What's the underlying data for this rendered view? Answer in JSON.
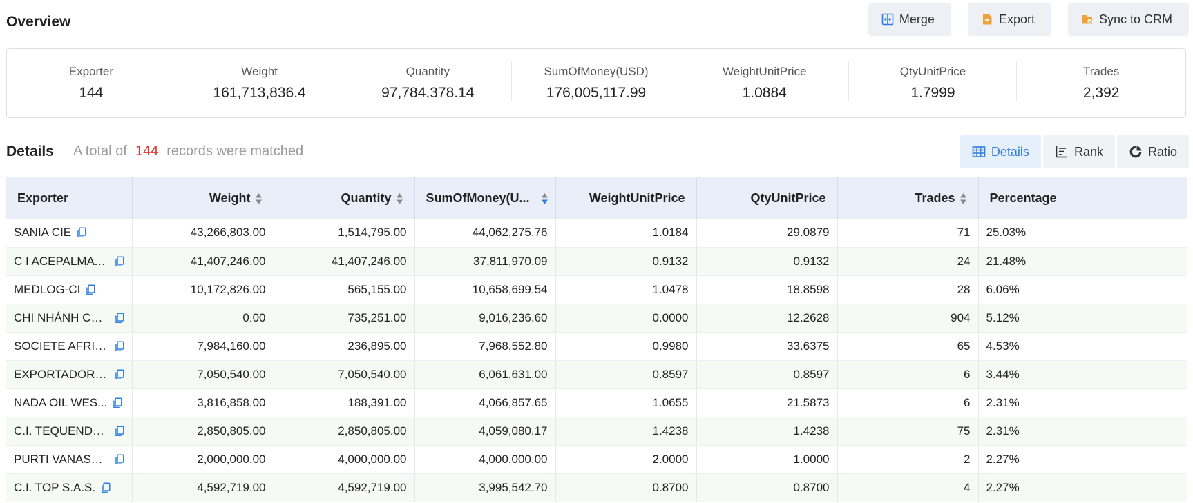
{
  "overview": {
    "title": "Overview",
    "actions": [
      {
        "label": "Merge",
        "icon": "merge-icon"
      },
      {
        "label": "Export",
        "icon": "export-icon"
      },
      {
        "label": "Sync to CRM",
        "icon": "sync-crm-icon"
      }
    ],
    "stats": [
      {
        "label": "Exporter",
        "value": "144"
      },
      {
        "label": "Weight",
        "value": "161,713,836.4"
      },
      {
        "label": "Quantity",
        "value": "97,784,378.14"
      },
      {
        "label": "SumOfMoney(USD)",
        "value": "176,005,117.99"
      },
      {
        "label": "WeightUnitPrice",
        "value": "1.0884"
      },
      {
        "label": "QtyUnitPrice",
        "value": "1.7999"
      },
      {
        "label": "Trades",
        "value": "2,392"
      }
    ]
  },
  "details": {
    "title": "Details",
    "matched_prefix": "A total of",
    "matched_count": "144",
    "matched_suffix": "records were matched",
    "views": [
      {
        "label": "Details",
        "icon": "table-icon",
        "active": true
      },
      {
        "label": "Rank",
        "icon": "rank-icon",
        "active": false
      },
      {
        "label": "Ratio",
        "icon": "pie-icon",
        "active": false
      }
    ]
  },
  "table": {
    "columns": [
      "Exporter",
      "Weight",
      "Quantity",
      "SumOfMoney(U...",
      "WeightUnitPrice",
      "QtyUnitPrice",
      "Trades",
      "Percentage"
    ],
    "rows": [
      [
        "SANIA CIE",
        "43,266,803.00",
        "1,514,795.00",
        "44,062,275.76",
        "1.0184",
        "29.0879",
        "71",
        "25.03%"
      ],
      [
        "C I ACEPALMA S A",
        "41,407,246.00",
        "41,407,246.00",
        "37,811,970.09",
        "0.9132",
        "0.9132",
        "24",
        "21.48%"
      ],
      [
        "MEDLOG-CI",
        "10,172,826.00",
        "565,155.00",
        "10,658,699.54",
        "1.0478",
        "18.8598",
        "28",
        "6.06%"
      ],
      [
        "CHI NHÁNH CÔ...",
        "0.00",
        "735,251.00",
        "9,016,236.60",
        "0.0000",
        "12.2628",
        "904",
        "5.12%"
      ],
      [
        "SOCIETE AFRIC...",
        "7,984,160.00",
        "236,895.00",
        "7,968,552.80",
        "0.9980",
        "33.6375",
        "65",
        "4.53%"
      ],
      [
        "EXPORTADORA ...",
        "7,050,540.00",
        "7,050,540.00",
        "6,061,631.00",
        "0.8597",
        "0.8597",
        "6",
        "3.44%"
      ],
      [
        "NADA OIL WES...",
        "3,816,858.00",
        "188,391.00",
        "4,066,857.65",
        "1.0655",
        "21.5873",
        "6",
        "2.31%"
      ],
      [
        "C.I. TEQUENDA...",
        "2,850,805.00",
        "2,850,805.00",
        "4,059,080.17",
        "1.4238",
        "1.4238",
        "75",
        "2.31%"
      ],
      [
        "PURTI VANASPA...",
        "2,000,000.00",
        "4,000,000.00",
        "4,000,000.00",
        "2.0000",
        "1.0000",
        "2",
        "2.27%"
      ],
      [
        "C.I. TOP S.A.S.",
        "4,592,719.00",
        "4,592,719.00",
        "3,995,542.70",
        "0.8700",
        "0.8700",
        "4",
        "2.27%"
      ]
    ]
  },
  "colors": {
    "accent": "#2f7de1",
    "count_red": "#e0322a",
    "icon_orange": "#f0a23a",
    "header_bg": "#e9eef9",
    "stripe_bg": "#f5faf4"
  }
}
